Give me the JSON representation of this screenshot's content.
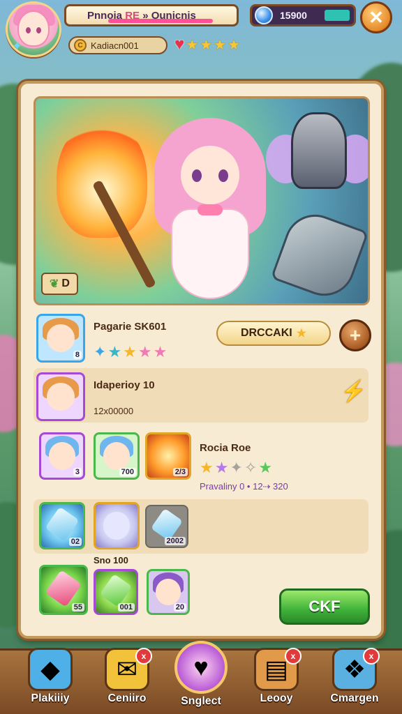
{
  "header": {
    "title_main": "Pnnoia",
    "title_accent": "RE",
    "title_rest": "» Ounicnis",
    "gems": "15900",
    "player_id": "Kadiacn001",
    "close_label": "✕",
    "coin_symbol": "C"
  },
  "hero": {
    "badge_label": "D"
  },
  "rows": {
    "r1": {
      "name": "Pagarie SK601",
      "card_label": "8",
      "button_label": "DRCCAKI",
      "add_label": "+"
    },
    "r2": {
      "name": "Idaperioy 10",
      "sub": "12x00000"
    },
    "r3": {
      "card1_label": "3",
      "card2_label": "700",
      "card3_label": "2/3",
      "name": "Rocia Roe",
      "sub": "Pravaliny 0 • 12⇢ 320"
    },
    "r4": {
      "card1_label": "02",
      "card3_label": "2002"
    },
    "r5": {
      "top_label": "Sno 100",
      "card1_label": "55",
      "card2_label": "001",
      "card3_label": "20"
    }
  },
  "confirm_label": "CKF",
  "nav": [
    {
      "label": "Plakiiiy",
      "icon": "crystal-icon",
      "color": "#4fb0e8"
    },
    {
      "label": "Ceniiro",
      "icon": "envelope-icon",
      "color": "#f2c23a",
      "badge": "x"
    },
    {
      "label": "Snglect",
      "icon": "heart-icon",
      "color": "#c86ae6"
    },
    {
      "label": "Leooy",
      "icon": "chest-icon",
      "color": "#e09a4a",
      "badge": "x"
    },
    {
      "label": "Cmargen",
      "icon": "gift-icon",
      "color": "#5ab0e0",
      "badge": "x"
    }
  ],
  "colors": {
    "panel": "#f7ecd3",
    "panel_border": "#c39a5e",
    "confirm": "#3fb23a",
    "close": "#e58a2a"
  }
}
